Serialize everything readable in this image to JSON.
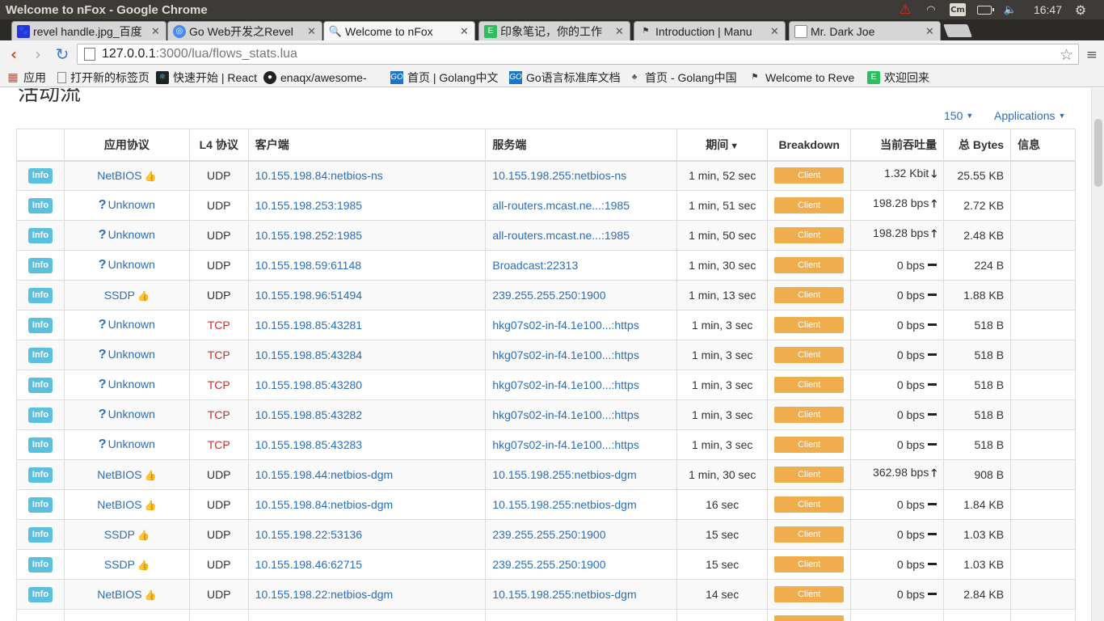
{
  "os": {
    "window_title": "Welcome to nFox - Google Chrome",
    "time": "16:47",
    "cm_label": "Cm"
  },
  "tabs": [
    {
      "label": "revel handle.jpg_百度",
      "favicon": "baidu-paw-icon",
      "active": false
    },
    {
      "label": "Go Web开发之Revel",
      "favicon": "chrome-icon",
      "active": false
    },
    {
      "label": "Welcome to nFox",
      "favicon": "search-icon",
      "active": true
    },
    {
      "label": "印象笔记，你的工作",
      "favicon": "evernote-icon",
      "active": false
    },
    {
      "label": "Introduction | Manu",
      "favicon": "revel-icon",
      "active": false
    },
    {
      "label": "Mr. Dark Joe",
      "favicon": "page-icon",
      "active": false
    }
  ],
  "toolbar": {
    "url_host": "127.0.0.1",
    "url_path": ":3000/lua/flows_stats.lua"
  },
  "bookmarks": [
    {
      "label": "应用",
      "icon": "apps-grid-icon"
    },
    {
      "label": "打开新的标签页",
      "icon": "page-icon"
    },
    {
      "label": "快速开始 | React",
      "icon": "react-icon"
    },
    {
      "label": "enaqx/awesome-",
      "icon": "github-icon"
    },
    {
      "label": "首页 | Golang中文",
      "icon": "golang-icon"
    },
    {
      "label": "Go语言标准库文档",
      "icon": "golang-icon"
    },
    {
      "label": "首页 - Golang中国",
      "icon": "gopher-icon"
    },
    {
      "label": "Welcome to Reve",
      "icon": "revel-icon"
    },
    {
      "label": "欢迎回来",
      "icon": "evernote-icon"
    }
  ],
  "page": {
    "heading_fragment": "活动流",
    "rows_per_page": "150",
    "apps_filter": "Applications"
  },
  "table": {
    "headers": {
      "info": "",
      "app": "应用协议",
      "l4": "L4 协议",
      "client": "客户端",
      "server": "服务端",
      "duration": "期间",
      "breakdown": "Breakdown",
      "throughput": "当前吞吐量",
      "bytes": "总 Bytes",
      "infocol": "信息"
    },
    "rows": [
      {
        "info": "Info",
        "app": "NetBIOS",
        "app_known": true,
        "l4": "UDP",
        "client_host": "10.155.198.84",
        "client_port": ":netbios-ns",
        "server_host": "10.155.198.255",
        "server_port": ":netbios-ns",
        "duration": "1 min, 52 sec",
        "breakdown": "Client",
        "throughput": "1.32 Kbit",
        "trend": "down",
        "bytes": "25.55 KB"
      },
      {
        "info": "Info",
        "app": "Unknown",
        "app_known": false,
        "l4": "UDP",
        "client_host": "10.155.198.253",
        "client_port": ":1985",
        "server_host": "all-routers.mcast.ne...",
        "server_port": ":1985",
        "duration": "1 min, 51 sec",
        "breakdown": "Client",
        "throughput": "198.28 bps",
        "trend": "up",
        "bytes": "2.72 KB"
      },
      {
        "info": "Info",
        "app": "Unknown",
        "app_known": false,
        "l4": "UDP",
        "client_host": "10.155.198.252",
        "client_port": ":1985",
        "server_host": "all-routers.mcast.ne...",
        "server_port": ":1985",
        "duration": "1 min, 50 sec",
        "breakdown": "Client",
        "throughput": "198.28 bps",
        "trend": "up",
        "bytes": "2.48 KB"
      },
      {
        "info": "Info",
        "app": "Unknown",
        "app_known": false,
        "l4": "UDP",
        "client_host": "10.155.198.59",
        "client_port": ":61148",
        "server_host": "Broadcast",
        "server_port": ":22313",
        "duration": "1 min, 30 sec",
        "breakdown": "Client",
        "throughput": "0 bps",
        "trend": "flat",
        "bytes": "224 B"
      },
      {
        "info": "Info",
        "app": "SSDP",
        "app_known": true,
        "l4": "UDP",
        "client_host": "10.155.198.96",
        "client_port": ":51494",
        "server_host": "239.255.255.250",
        "server_port": ":1900",
        "duration": "1 min, 13 sec",
        "breakdown": "Client",
        "throughput": "0 bps",
        "trend": "flat",
        "bytes": "1.88 KB"
      },
      {
        "info": "Info",
        "app": "Unknown",
        "app_known": false,
        "l4": "TCP",
        "client_host": "10.155.198.85",
        "client_port": ":43281",
        "server_host": "hkg07s02-in-f4.1e100...",
        "server_port": ":https",
        "duration": "1 min, 3 sec",
        "breakdown": "Client",
        "throughput": "0 bps",
        "trend": "flat",
        "bytes": "518 B"
      },
      {
        "info": "Info",
        "app": "Unknown",
        "app_known": false,
        "l4": "TCP",
        "client_host": "10.155.198.85",
        "client_port": ":43284",
        "server_host": "hkg07s02-in-f4.1e100...",
        "server_port": ":https",
        "duration": "1 min, 3 sec",
        "breakdown": "Client",
        "throughput": "0 bps",
        "trend": "flat",
        "bytes": "518 B"
      },
      {
        "info": "Info",
        "app": "Unknown",
        "app_known": false,
        "l4": "TCP",
        "client_host": "10.155.198.85",
        "client_port": ":43280",
        "server_host": "hkg07s02-in-f4.1e100...",
        "server_port": ":https",
        "duration": "1 min, 3 sec",
        "breakdown": "Client",
        "throughput": "0 bps",
        "trend": "flat",
        "bytes": "518 B"
      },
      {
        "info": "Info",
        "app": "Unknown",
        "app_known": false,
        "l4": "TCP",
        "client_host": "10.155.198.85",
        "client_port": ":43282",
        "server_host": "hkg07s02-in-f4.1e100...",
        "server_port": ":https",
        "duration": "1 min, 3 sec",
        "breakdown": "Client",
        "throughput": "0 bps",
        "trend": "flat",
        "bytes": "518 B"
      },
      {
        "info": "Info",
        "app": "Unknown",
        "app_known": false,
        "l4": "TCP",
        "client_host": "10.155.198.85",
        "client_port": ":43283",
        "server_host": "hkg07s02-in-f4.1e100...",
        "server_port": ":https",
        "duration": "1 min, 3 sec",
        "breakdown": "Client",
        "throughput": "0 bps",
        "trend": "flat",
        "bytes": "518 B"
      },
      {
        "info": "Info",
        "app": "NetBIOS",
        "app_known": true,
        "l4": "UDP",
        "client_host": "10.155.198.44",
        "client_port": ":netbios-dgm",
        "server_host": "10.155.198.255",
        "server_port": ":netbios-dgm",
        "duration": "1 min, 30 sec",
        "breakdown": "Client",
        "throughput": "362.98 bps",
        "trend": "up",
        "bytes": "908 B"
      },
      {
        "info": "Info",
        "app": "NetBIOS",
        "app_known": true,
        "l4": "UDP",
        "client_host": "10.155.198.84",
        "client_port": ":netbios-dgm",
        "server_host": "10.155.198.255",
        "server_port": ":netbios-dgm",
        "duration": "16 sec",
        "breakdown": "Client",
        "throughput": "0 bps",
        "trend": "flat",
        "bytes": "1.84 KB"
      },
      {
        "info": "Info",
        "app": "SSDP",
        "app_known": true,
        "l4": "UDP",
        "client_host": "10.155.198.22",
        "client_port": ":53136",
        "server_host": "239.255.255.250",
        "server_port": ":1900",
        "duration": "15 sec",
        "breakdown": "Client",
        "throughput": "0 bps",
        "trend": "flat",
        "bytes": "1.03 KB"
      },
      {
        "info": "Info",
        "app": "SSDP",
        "app_known": true,
        "l4": "UDP",
        "client_host": "10.155.198.46",
        "client_port": ":62715",
        "server_host": "239.255.255.250",
        "server_port": ":1900",
        "duration": "15 sec",
        "breakdown": "Client",
        "throughput": "0 bps",
        "trend": "flat",
        "bytes": "1.03 KB"
      },
      {
        "info": "Info",
        "app": "NetBIOS",
        "app_known": true,
        "l4": "UDP",
        "client_host": "10.155.198.22",
        "client_port": ":netbios-dgm",
        "server_host": "10.155.198.255",
        "server_port": ":netbios-dgm",
        "duration": "14 sec",
        "breakdown": "Client",
        "throughput": "0 bps",
        "trend": "flat",
        "bytes": "2.84 KB"
      }
    ]
  },
  "colors": {
    "link": "#2a6ebb",
    "info_label": "#5bc0de",
    "client_bar": "#f0ad4e",
    "tcp": "#c9302c"
  }
}
